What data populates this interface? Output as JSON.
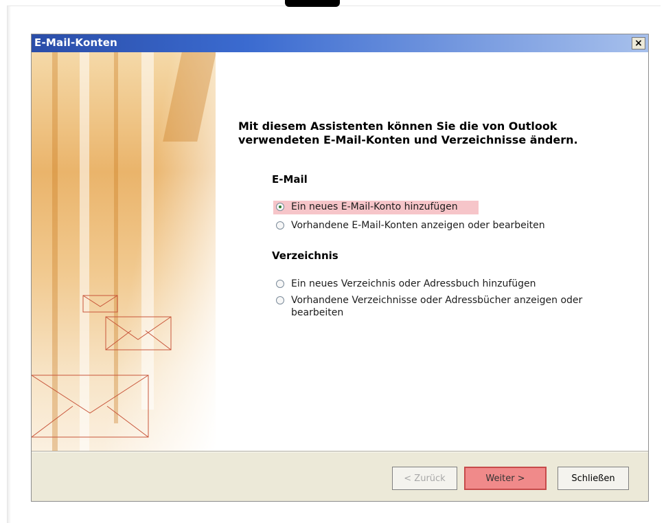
{
  "window": {
    "title": "E-Mail-Konten",
    "close_label": "×"
  },
  "intro": "Mit diesem Assistenten können Sie die von Outlook verwendeten E-Mail-Konten und Verzeichnisse ändern.",
  "email_section": {
    "label": "E-Mail",
    "options": [
      {
        "label": "Ein neues E-Mail-Konto hinzufügen",
        "selected": true
      },
      {
        "label": "Vorhandene E-Mail-Konten anzeigen oder bearbeiten",
        "selected": false
      }
    ]
  },
  "directory_section": {
    "label": "Verzeichnis",
    "options": [
      {
        "label": "Ein neues Verzeichnis oder Adressbuch hinzufügen",
        "selected": false
      },
      {
        "label": "Vorhandene Verzeichnisse oder Adressbücher anzeigen oder bearbeiten",
        "selected": false
      }
    ]
  },
  "buttons": {
    "back": "< Zurück",
    "next": "Weiter >",
    "close": "Schließen"
  },
  "colors": {
    "titlebar": "#3b6bd0",
    "highlight": "#e65a64",
    "dialog_bg": "#ece9d8"
  }
}
